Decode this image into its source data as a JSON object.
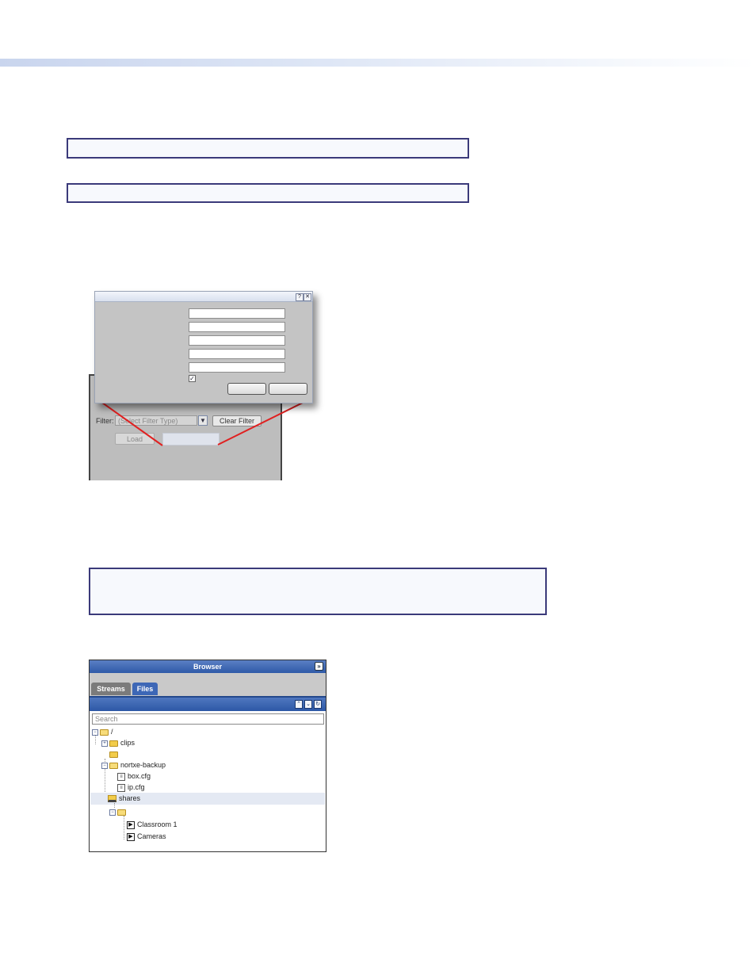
{
  "filter_panel": {
    "filter_label": "Filter:",
    "filter_placeholder": "(Select Filter Type)",
    "clear_filter_label": "Clear Filter",
    "load_label": "Load"
  },
  "dialog": {
    "title": "",
    "help_glyph": "?",
    "close_glyph": "✕",
    "check_glyph": "✓",
    "ok_label": "",
    "cancel_label": ""
  },
  "browser": {
    "title": "Browser",
    "collapse_glyph": "»",
    "tabs": [
      {
        "label": "Streams"
      },
      {
        "label": "Files"
      }
    ],
    "active_tab": "Files",
    "toolbar_glyphs": [
      "⌃",
      "⌄",
      "↻"
    ],
    "search_placeholder": "Search",
    "tree": [
      {
        "label": "/",
        "icon": "folder-open-icon",
        "expander": "−"
      },
      {
        "label": "clips",
        "icon": "folder-icon",
        "expander": "+"
      },
      {
        "label": "",
        "icon": "folder-icon"
      },
      {
        "label": "nortxe-backup",
        "icon": "folder-open-icon",
        "expander": "−"
      },
      {
        "label": "box.cfg",
        "icon": "file-icon"
      },
      {
        "label": "ip.cfg",
        "icon": "file-icon"
      },
      {
        "label": "shares",
        "icon": "share-icon",
        "selected": true
      },
      {
        "label": "",
        "icon": "folder-open-icon",
        "expander": "−"
      },
      {
        "label": "Classroom 1",
        "icon": "stream-icon"
      },
      {
        "label": "Cameras",
        "icon": "stream-icon"
      }
    ]
  },
  "colors": {
    "note_border": "#3b3a7a",
    "callout_line": "#e02020",
    "browser_header": "#2f5aa8"
  }
}
